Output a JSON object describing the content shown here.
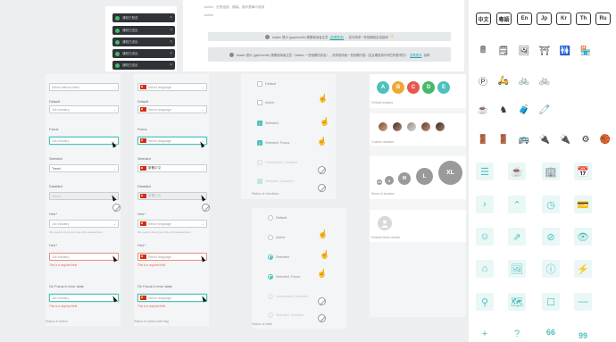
{
  "toasts": [
    {
      "text": "通知已發送"
    },
    {
      "text": "通知已送出"
    },
    {
      "text": "通知已送出"
    },
    {
      "text": "通知已送出"
    },
    {
      "text": "通知已送出"
    }
  ],
  "banner": {
    "caption": "Action · 在對話框、橫幅、操作選單中使用",
    "caption2": "Action",
    "note1": {
      "pre": "Asiabc 提示 (gap/needle) 需要使用者注意",
      "link": "(查看更多)",
      "post": "，並可請求一些相關設定或說明",
      "warn": "⚠"
    },
    "note2": {
      "pre": "Asiabc 提示 (gap/needle) 需要使用者注意（Asiabc 一些相關的訊息）。請求使用者一些相關行動（並且確保用戶明白所要求的）",
      "link": "查看更多",
      "post": "說明"
    }
  },
  "form_left": {
    "fields": [
      {
        "label": "",
        "value": "Select without label"
      },
      {
        "label": "Default",
        "value": "Job industry"
      },
      {
        "label": "Focus",
        "value": "Job industry"
      },
      {
        "label": "Selected",
        "value": "Travel"
      },
      {
        "label": "Disabled",
        "value": "Travel"
      },
      {
        "label": "Hint *",
        "value": "Job industry",
        "hint": "We need to know your title with selected item"
      },
      {
        "label": "Hint *",
        "value": "Job industry",
        "error": "This is a required field"
      },
      {
        "label": "On Focus in error state",
        "value": "Job industry",
        "error": "This is a required field"
      }
    ],
    "footer": "Status of select"
  },
  "form_right": {
    "fields": [
      {
        "label": "",
        "value": "Select language"
      },
      {
        "label": "Default",
        "value": "Select language"
      },
      {
        "label": "Focus",
        "value": "Select language"
      },
      {
        "label": "Selected",
        "value": "繁體中文"
      },
      {
        "label": "Disabled",
        "value": "繁體中文"
      },
      {
        "label": "Hint *",
        "value": "Select language",
        "hint": "We need to know your title with selected item"
      },
      {
        "label": "Hint *",
        "value": "Select language",
        "error": "This is a required field"
      },
      {
        "label": "On Focus in error state",
        "value": "Select language",
        "error": "This is a required field"
      }
    ],
    "footer": "Status of select with flag"
  },
  "checkboxes": {
    "items": [
      "Default",
      "Active",
      "Selected",
      "Selected, Focus",
      "Unselected, Disabled",
      "Selected, Disabled"
    ],
    "footer": "Status of checkbox"
  },
  "radios": {
    "items": [
      "Default",
      "Active",
      "Selected",
      "Selected, Focus",
      "Unselected, Disabled",
      "Selected, Disabled"
    ],
    "footer": "Status of radio"
  },
  "avatars": {
    "colors": [
      "#4fc1bc",
      "#f1a736",
      "#e6574e",
      "#47b86b",
      "#4fc1bc"
    ],
    "letters": [
      "A",
      "B",
      "C",
      "D",
      "E"
    ],
    "caption1": "Default avatars",
    "caption2": "Custom avatars",
    "sizes": [
      "XS",
      "S",
      "M",
      "L",
      "XL"
    ],
    "caption3": "Sizes of avatars",
    "caption4": "Default blank avatar"
  },
  "icons": {
    "lang_row": [
      "中文",
      "粵語",
      "En",
      "Jp",
      "Kr",
      "Th",
      "Ru"
    ],
    "row2": [
      "🖩",
      "🗒",
      "🖼",
      "⛩",
      "🚻",
      "🏪"
    ],
    "row3": [
      "Ⓟ",
      "🛵",
      "🚲",
      "🚲"
    ],
    "row4": [
      "☕",
      "♞",
      "🧳",
      "🧷"
    ],
    "row5": [
      "🚪",
      "🚪",
      "🚌",
      "🔌",
      "🔌",
      "⚙",
      "🏀"
    ],
    "teal": [
      "☰",
      "☕",
      "🏢",
      "📅",
      "›",
      "⌃",
      "◷",
      "💳",
      "☺",
      "⇗",
      "⊘",
      "👁",
      "⌂",
      "🖼",
      "ⓘ",
      "⚡",
      "⚲",
      "🗺",
      "☐",
      "—",
      "+",
      "?",
      "66",
      "99"
    ]
  }
}
